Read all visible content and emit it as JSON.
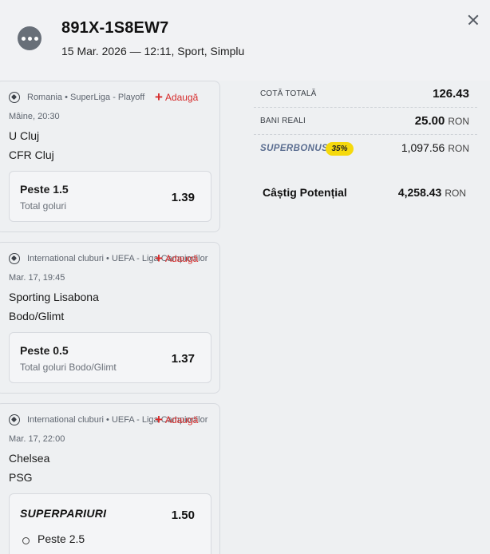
{
  "header": {
    "ticket_id": "891X-1S8EW7",
    "subtitle": "15 Mar. 2026 — 12:11, Sport, Simplu",
    "icons": {
      "avatar": "more-dots-icon",
      "close": "close-icon"
    }
  },
  "events": [
    {
      "league": "Romania • SuperLiga - Playoff",
      "add_label": "Adaugă",
      "time": "Mâine, 20:30",
      "home": "U Cluj",
      "away": "CFR Cluj",
      "pick": {
        "name": "Peste 1.5",
        "market": "Total goluri",
        "odd": "1.39"
      }
    },
    {
      "league": "International cluburi • UEFA - Liga Campionilor",
      "add_label": "Adaugă",
      "time": "Mar. 17, 19:45",
      "home": "Sporting Lisabona",
      "away": "Bodo/Glimt",
      "pick": {
        "name": "Peste 0.5",
        "market": "Total goluri Bodo/Glimt",
        "odd": "1.37"
      }
    },
    {
      "league": "International cluburi • UEFA - Liga Campionilor",
      "add_label": "Adaugă",
      "time": "Mar. 17, 22:00",
      "home": "Chelsea",
      "away": "PSG",
      "superpariuri": {
        "title": "SUPERPARIURI",
        "odd": "1.50",
        "first_pick": "Peste 2.5"
      }
    }
  ],
  "summary": {
    "total_odds_label": "COTĂ TOTALĂ",
    "total_odds": "126.43",
    "stake_label": "BANI REALI",
    "stake": "25.00",
    "currency": "RON",
    "superbonus_label": "SUPERBONUS",
    "superbonus_pct": "35%",
    "superbonus_value": "1,097.56",
    "potential_label": "Câștig Potențial",
    "potential_value": "4,258.43"
  },
  "colors": {
    "accent_red": "#d62b2b",
    "badge_yellow": "#f5d90c",
    "superbonus_text": "#5b6e91"
  }
}
